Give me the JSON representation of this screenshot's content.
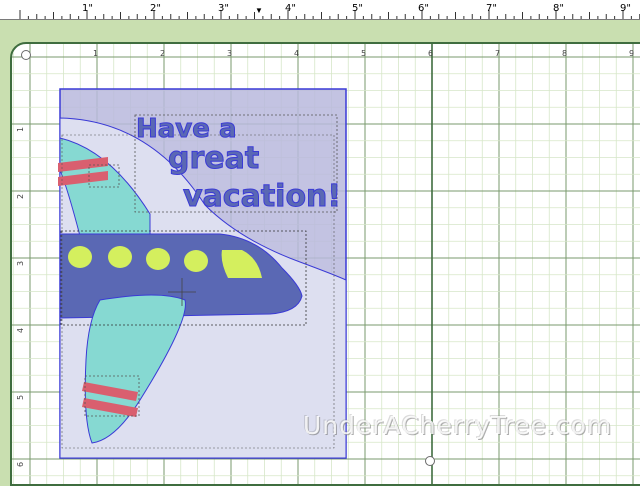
{
  "ruler": {
    "labels": [
      "1\"",
      "2\"",
      "3\"",
      "4\"",
      "5\"",
      "6\"",
      "7\"",
      "8\"",
      "9\""
    ],
    "marker_icon": "down-triangle"
  },
  "mat": {
    "top_numbers": [
      "1",
      "2",
      "3",
      "4",
      "5",
      "6",
      "7",
      "8",
      "9"
    ],
    "side_numbers": [
      "1",
      "2",
      "3",
      "4",
      "5",
      "6"
    ]
  },
  "design": {
    "title_lines": [
      "Have a",
      "great",
      "vacation!"
    ]
  },
  "colors": {
    "mat_background": "#c9dfb0",
    "mat_border": "#3f6d3f",
    "grid_minor": "#d6e6c8",
    "grid_major": "#7a9a6e",
    "card_fill": "#b8b8dd",
    "card_border": "#3a3ad6",
    "cloud_fill": "#dddff0",
    "plane_body": "#5a68b4",
    "wing": "#86d9d2",
    "window": "#d4ef5e",
    "stripes": "#d95f6f"
  },
  "watermark": "UnderACherryTree.com"
}
